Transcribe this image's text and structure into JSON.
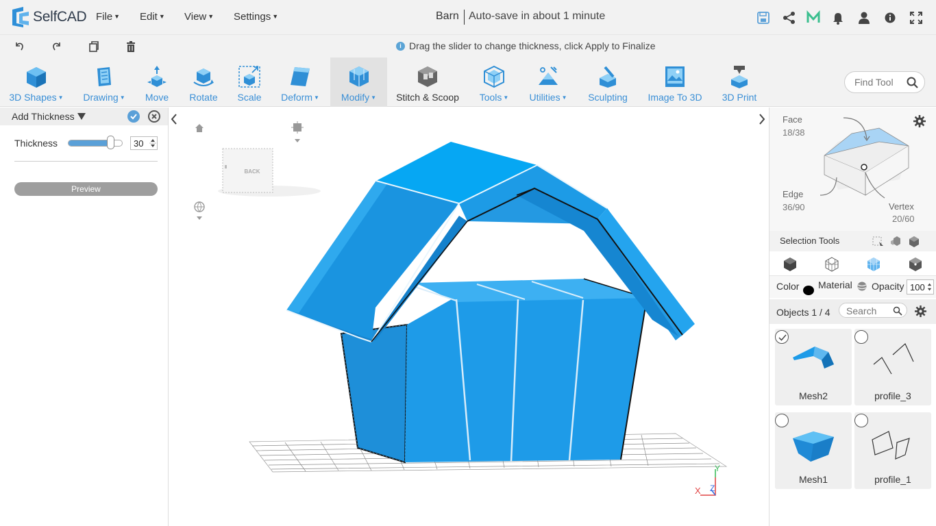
{
  "app": {
    "logo_text": "SelfCAD",
    "menus": [
      {
        "label": "File"
      },
      {
        "label": "Edit"
      },
      {
        "label": "View"
      },
      {
        "label": "Settings"
      }
    ],
    "document_title": "Barn",
    "autosave_text": "Auto-save in about 1 minute",
    "top_icons": [
      "save-icon",
      "share-icon",
      "m-brand-icon",
      "bell-icon",
      "user-icon",
      "info-icon",
      "fullscreen-icon"
    ]
  },
  "toolbar2": {
    "icons": [
      "undo-icon",
      "redo-icon",
      "copy-icon",
      "delete-icon"
    ],
    "hint": "Drag the slider to change thickness, click Apply to Finalize"
  },
  "ribbon": {
    "tools": [
      {
        "label": "3D Shapes",
        "dropdown": true
      },
      {
        "label": "Drawing",
        "dropdown": true
      },
      {
        "label": "Move",
        "dropdown": false
      },
      {
        "label": "Rotate",
        "dropdown": false
      },
      {
        "label": "Scale",
        "dropdown": false
      },
      {
        "label": "Deform",
        "dropdown": true
      },
      {
        "label": "Modify",
        "dropdown": true
      },
      {
        "label": "Stitch & Scoop",
        "dropdown": false
      },
      {
        "label": "Tools",
        "dropdown": true
      },
      {
        "label": "Utilities",
        "dropdown": true
      },
      {
        "label": "Sculpting",
        "dropdown": false
      },
      {
        "label": "Image To 3D",
        "dropdown": false
      },
      {
        "label": "3D Print",
        "dropdown": false
      }
    ],
    "active_tool": "Modify",
    "find_tool_placeholder": "Find Tool",
    "accent_color": "#3a8fd6"
  },
  "left_panel": {
    "title": "Add Thickness",
    "thickness_label": "Thickness",
    "thickness_value": "30",
    "thickness_level_fraction": 0.78,
    "preview_label": "Preview"
  },
  "viewport": {
    "view_cube_label": "BACK",
    "axis_labels": {
      "x": "X",
      "y": "Y",
      "z": "Z"
    },
    "model_color": "#1e9be8"
  },
  "right_panel": {
    "selection": {
      "face_label": "Face",
      "face_count": "18/38",
      "edge_label": "Edge",
      "edge_count": "36/90",
      "vertex_label": "Vertex",
      "vertex_count": "20/60"
    },
    "selection_tools_label": "Selection Tools",
    "color_label": "Color",
    "color_value": "#000000",
    "material_label": "Material",
    "opacity_label": "Opacity",
    "opacity_value": "100",
    "objects_label": "Objects 1 / 4",
    "search_placeholder": "Search",
    "objects": [
      {
        "name": "Mesh2",
        "selected": true
      },
      {
        "name": "profile_3",
        "selected": false
      },
      {
        "name": "Mesh1",
        "selected": false
      },
      {
        "name": "profile_1",
        "selected": false
      }
    ]
  }
}
